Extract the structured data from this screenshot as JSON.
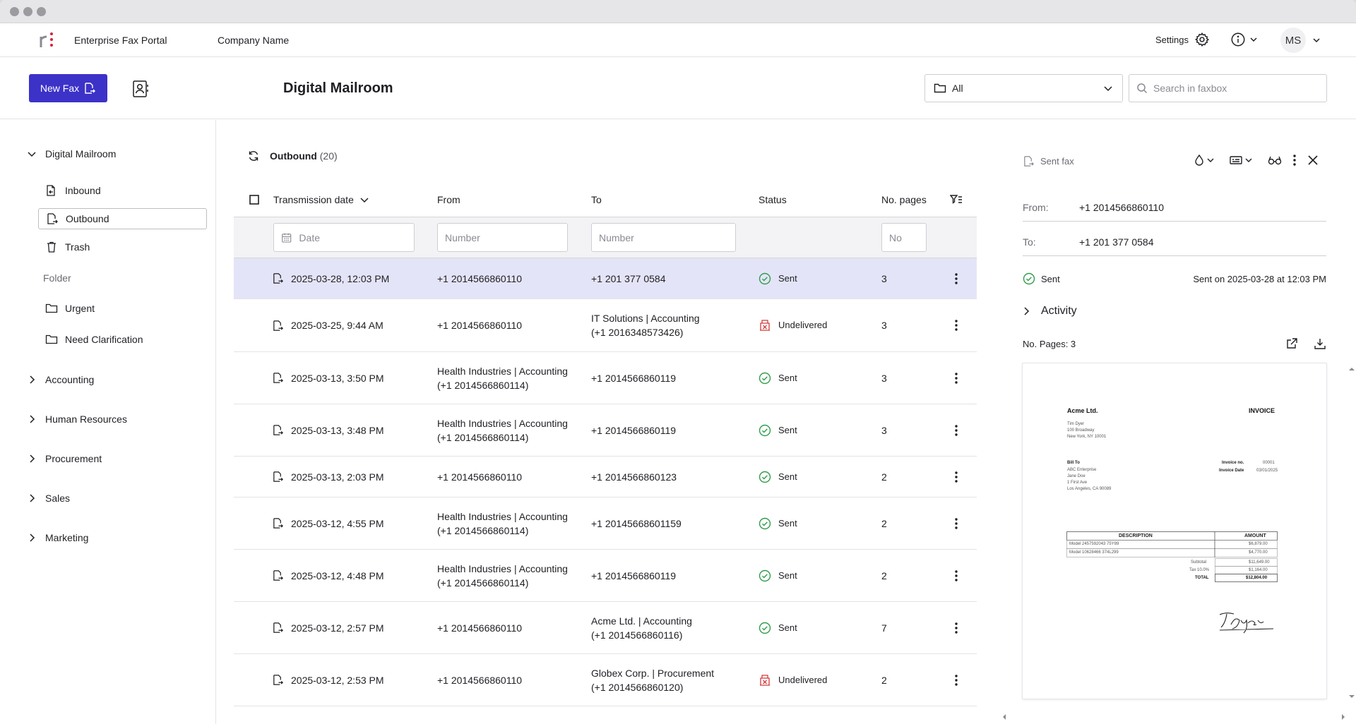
{
  "app": {
    "name": "Enterprise Fax Portal",
    "company": "Company Name",
    "settings_label": "Settings",
    "avatar_initials": "MS",
    "accent": "#3c32c8"
  },
  "toolbar": {
    "new_fax_label": "New Fax",
    "page_title": "Digital Mailroom",
    "folder_select": "All",
    "search_placeholder": "Search in faxbox"
  },
  "sidebar": {
    "root": "Digital Mailroom",
    "items": [
      "Inbound",
      "Outbound",
      "Trash"
    ],
    "folder_label": "Folder",
    "folders": [
      "Urgent",
      "Need Clarification"
    ],
    "groups": [
      "Accounting",
      "Human Resources",
      "Procurement",
      "Sales",
      "Marketing"
    ]
  },
  "list": {
    "title": "Outbound",
    "count": "(20)",
    "columns": {
      "date": "Transmission date",
      "from": "From",
      "to": "To",
      "status": "Status",
      "pages": "No. pages"
    },
    "filters": {
      "date": "Date",
      "from": "Number",
      "to": "Number",
      "pages": "No"
    },
    "rows": [
      {
        "date": "2025-03-28, 12:03 PM",
        "from": [
          "+1 2014566860110"
        ],
        "to": [
          "+1 201 377 0584"
        ],
        "status": "Sent",
        "pages": "3"
      },
      {
        "date": "2025-03-25, 9:44 AM",
        "from": [
          "+1 2014566860110"
        ],
        "to": [
          "IT Solutions | Accounting",
          "(+1 2016348573426)"
        ],
        "status": "Undelivered",
        "pages": "3"
      },
      {
        "date": "2025-03-13, 3:50 PM",
        "from": [
          "Health Industries | Accounting",
          "(+1 2014566860114)"
        ],
        "to": [
          "+1 2014566860119"
        ],
        "status": "Sent",
        "pages": "3"
      },
      {
        "date": "2025-03-13, 3:48 PM",
        "from": [
          "Health Industries | Accounting",
          "(+1 2014566860114)"
        ],
        "to": [
          "+1 2014566860119"
        ],
        "status": "Sent",
        "pages": "3"
      },
      {
        "date": "2025-03-13, 2:03 PM",
        "from": [
          "+1 2014566860110"
        ],
        "to": [
          "+1 2014566860123"
        ],
        "status": "Sent",
        "pages": "2"
      },
      {
        "date": "2025-03-12, 4:55 PM",
        "from": [
          "Health Industries | Accounting",
          "(+1 2014566860114)"
        ],
        "to": [
          "+1 20145668601159"
        ],
        "status": "Sent",
        "pages": "2"
      },
      {
        "date": "2025-03-12, 4:48 PM",
        "from": [
          "Health Industries | Accounting",
          "(+1 2014566860114)"
        ],
        "to": [
          "+1 2014566860119"
        ],
        "status": "Sent",
        "pages": "2"
      },
      {
        "date": "2025-03-12, 2:57 PM",
        "from": [
          "+1 2014566860110"
        ],
        "to": [
          "Acme Ltd. | Accounting",
          "(+1 2014566860116)"
        ],
        "status": "Sent",
        "pages": "7"
      },
      {
        "date": "2025-03-12, 2:53 PM",
        "from": [
          "+1 2014566860110"
        ],
        "to": [
          "Globex Corp. | Procurement",
          "(+1 2014566860120)"
        ],
        "status": "Undelivered",
        "pages": "2"
      }
    ],
    "status_colors": {
      "Sent": "#2e9d4a",
      "Undelivered": "#d23a3a"
    }
  },
  "detail": {
    "kind": "Sent fax",
    "from_label": "From:",
    "from_value": "+1 2014566860110",
    "to_label": "To:",
    "to_value": "+1 201 377 0584",
    "status": "Sent",
    "sent_on": "Sent on 2025-03-28 at 12:03 PM",
    "activity": "Activity",
    "pages": "No. Pages: 3",
    "invoice": {
      "company": "Acme Ltd.",
      "title": "INVOICE",
      "sender": [
        "Tim Dyer",
        "100 Broadway",
        "New York, NY 10001"
      ],
      "bill_to_label": "Bill To",
      "bill_to": [
        "ABC Enterprise",
        "Jane Doe",
        "1 First Ave",
        "Los Angeles, CA 90089"
      ],
      "invoice_no_label": "Invoice no.",
      "invoice_no": "00001",
      "invoice_date_label": "Invoice Date",
      "invoice_date": "03/01/2025",
      "col_desc": "DESCRIPTION",
      "col_amount": "AMOUNT",
      "lines": [
        {
          "desc": "Model 2457592043 75Y89",
          "amount": "$6,879.00"
        },
        {
          "desc": "Model 10628466 374L299",
          "amount": "$4,770.00"
        }
      ],
      "subtotal_label": "Subtotal",
      "subtotal": "$11,649.00",
      "tax_label": "Tax 10.0%",
      "tax": "$1,164.00",
      "total_label": "TOTAL",
      "total": "$12,804.00",
      "signature": "T. Dyer"
    }
  }
}
